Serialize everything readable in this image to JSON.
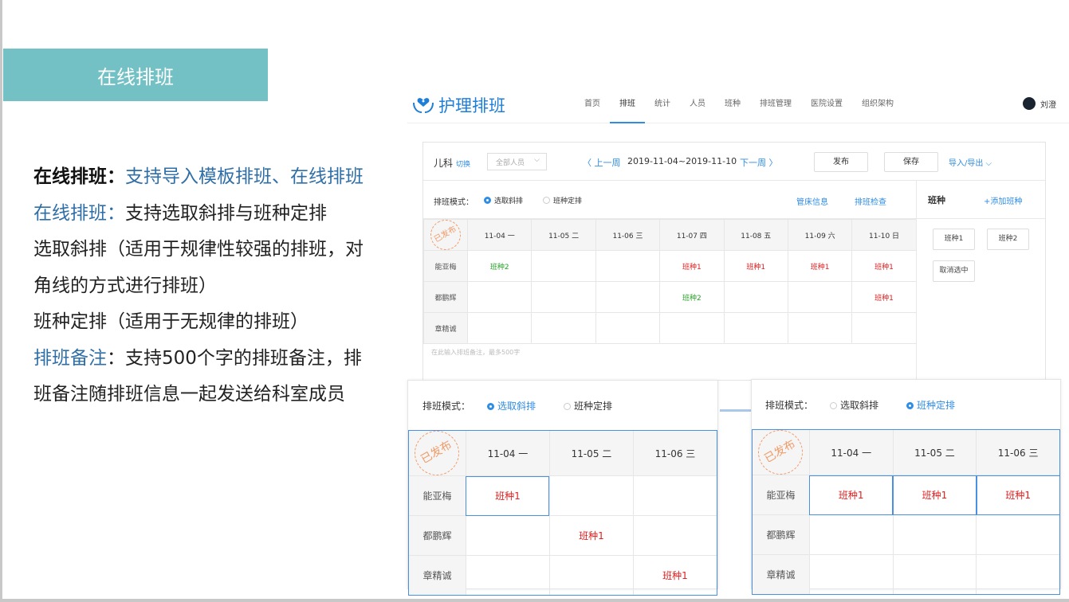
{
  "banner": "在线排班",
  "desc": {
    "l1_bold": "在线排班：",
    "l1_blue": "支持导入模板排班、在线排班",
    "l2_blue": "在线排班：",
    "l2_text": "支持选取斜排与班种定排",
    "l3": "选取斜排（适用于规律性较强的排班，对角线的方式进行排班）",
    "l4": "班种定排（适用于无规律的排班）",
    "l5_blue": "排班备注",
    "l5_text": "：支持500个字的排班备注，排班备注随排班信息一起发送给科室成员"
  },
  "app": {
    "logo": "护理排班",
    "nav": [
      "首页",
      "排班",
      "统计",
      "人员",
      "班种",
      "排班管理",
      "医院设置",
      "组织架构"
    ],
    "nav_active": 1,
    "user": "刘澄"
  },
  "toolbar": {
    "dept": "儿科",
    "switch": "切换",
    "filter": "全部人员",
    "prev": "〈 上一周",
    "range": "2019-11-04~2019-11-10",
    "next": "下一周 〉",
    "publish": "发布",
    "save": "保存",
    "import": "导入/导出 ⌵"
  },
  "mode": {
    "label": "排班模式：",
    "opt1": "选取斜排",
    "opt2": "班种定排",
    "bed_info": "管床信息",
    "check": "排班检查"
  },
  "side": {
    "title": "班种",
    "add": "+添加班种",
    "shift1": "班种1",
    "shift2": "班种2",
    "cancel": "取消选中"
  },
  "stamp": "已发布",
  "days": [
    "11-04 一",
    "11-05 二",
    "11-06 三",
    "11-07 四",
    "11-08 五",
    "11-09 六",
    "11-10 日"
  ],
  "staff": [
    "能亚梅",
    "都鹏辉",
    "章精诚"
  ],
  "cells": [
    [
      "班种2",
      "",
      "",
      "班种1",
      "班种1",
      "班种1",
      "班种1"
    ],
    [
      "",
      "",
      "",
      "班种2",
      "",
      "",
      "班种1"
    ],
    [
      "",
      "",
      "",
      "",
      "",
      "",
      ""
    ]
  ],
  "remark_placeholder": "在此输入排班备注，最多500字",
  "left_cells": [
    [
      "班种1",
      "",
      ""
    ],
    [
      "",
      "班种1",
      ""
    ],
    [
      "",
      "",
      "班种1"
    ]
  ],
  "right_cells": [
    [
      "班种1",
      "班种1",
      "班种1"
    ],
    [
      "",
      "",
      ""
    ],
    [
      "",
      "",
      ""
    ]
  ],
  "colors": {
    "accent": "#2f8de4",
    "banner": "#74c1c5",
    "red": "#e02020",
    "green": "#2aa12a",
    "stamp": "#ef9c6a"
  }
}
